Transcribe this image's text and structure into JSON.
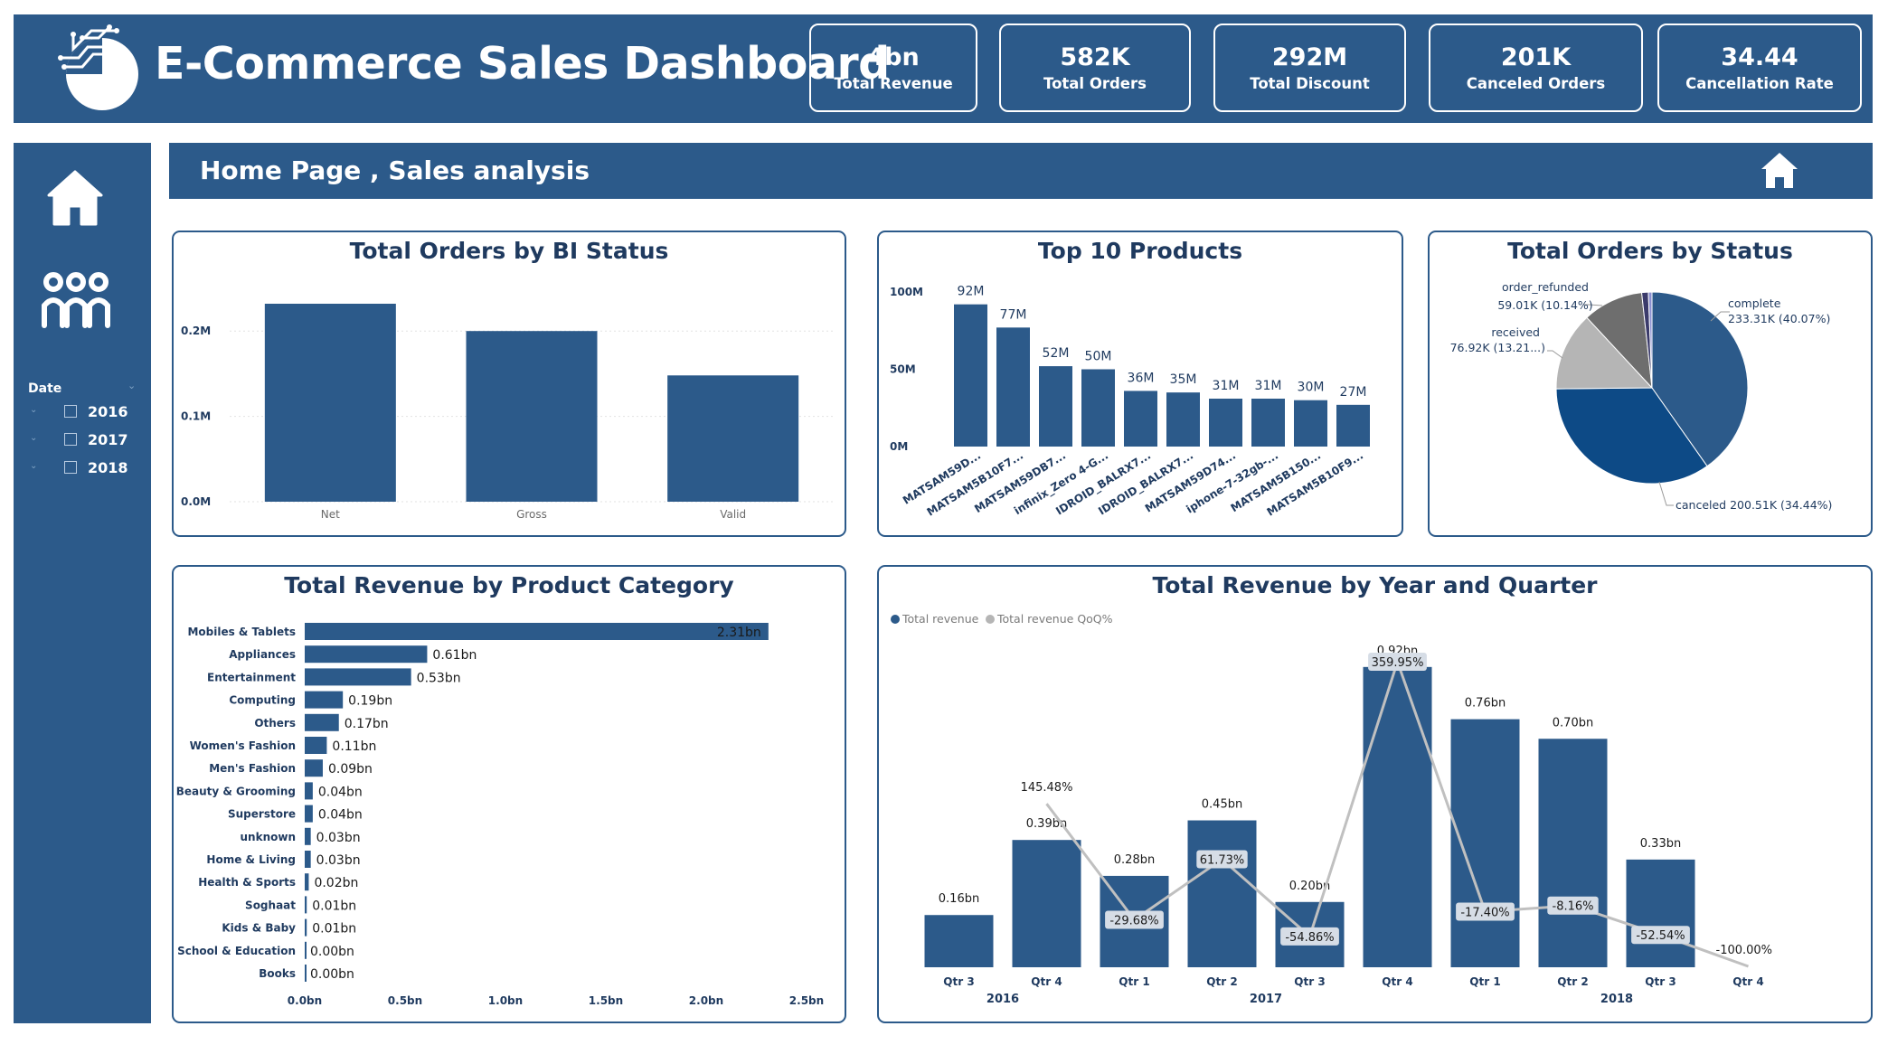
{
  "header": {
    "title": "E-Commerce Sales Dashboard",
    "kpis": [
      {
        "value": "4bn",
        "label": "Total Revenue"
      },
      {
        "value": "582K",
        "label": "Total Orders"
      },
      {
        "value": "292M",
        "label": "Total Discount"
      },
      {
        "value": "201K",
        "label": "Canceled Orders"
      },
      {
        "value": "34.44",
        "label": "Cancellation Rate"
      }
    ]
  },
  "sidebar": {
    "date_label": "Date",
    "years": [
      "2016",
      "2017",
      "2018"
    ]
  },
  "page": {
    "title": "Home Page , Sales analysis"
  },
  "colors": {
    "navy": "#2c5a8a",
    "bar": "#2c5a8a",
    "pie_dark": "#0d4a86",
    "gray": "#b5b5b5",
    "darkgray": "#6e6e6e",
    "line": "#c0c0c0"
  },
  "chart_data": [
    {
      "id": "bi_status",
      "type": "bar",
      "title": "Total Orders by BI Status",
      "categories": [
        "Net",
        "Gross",
        "Valid"
      ],
      "values": [
        0.232,
        0.2,
        0.148
      ],
      "ylim": [
        0,
        0.25
      ],
      "yticks": [
        0,
        0.1,
        0.2
      ],
      "ytick_labels": [
        "0.0M",
        "0.1M",
        "0.2M"
      ],
      "grid": true
    },
    {
      "id": "top_products",
      "type": "bar",
      "title": "Top 10 Products",
      "categories": [
        "MATSAM59D...",
        "MATSAM5B10F7...",
        "MATSAM59DB7...",
        "infinix_Zero 4-G...",
        "IDROID_BALRX7...",
        "IDROID_BALRX7...",
        "MATSAM59D74...",
        "iphone-7-32gb-...",
        "MATSAM5B150...",
        "MATSAM5B10F9..."
      ],
      "values": [
        92,
        77,
        52,
        50,
        36,
        35,
        31,
        31,
        30,
        27
      ],
      "data_labels": [
        "92M",
        "77M",
        "52M",
        "50M",
        "36M",
        "35M",
        "31M",
        "31M",
        "30M",
        "27M"
      ],
      "ylim": [
        0,
        100
      ],
      "yticks": [
        0,
        50,
        100
      ],
      "ytick_labels": [
        "0M",
        "50M",
        "100M"
      ]
    },
    {
      "id": "orders_status",
      "type": "pie",
      "title": "Total Orders by Status",
      "slices": [
        {
          "name": "complete",
          "value": 233.31,
          "label1": "complete",
          "label2": "233.31K (40.07%)",
          "color": "#2c5a8a"
        },
        {
          "name": "canceled",
          "value": 200.51,
          "label1": "canceled 200.51K (34.44%)",
          "label2": "",
          "color": "#0d4a86"
        },
        {
          "name": "received",
          "value": 76.92,
          "label1": "received",
          "label2": "76.92K (13.21...)",
          "color": "#b5b5b5"
        },
        {
          "name": "order_refunded",
          "value": 59.01,
          "label1": "order_refunded",
          "label2": "59.01K (10.14%)",
          "color": "#6e6e6e"
        },
        {
          "name": "other_a",
          "value": 6.5,
          "label1": "",
          "label2": "",
          "color": "#3b3b6b"
        },
        {
          "name": "other_b",
          "value": 3.5,
          "label1": "",
          "label2": "",
          "color": "#8a8fd0"
        }
      ]
    },
    {
      "id": "category_revenue",
      "type": "bar",
      "orientation": "horizontal",
      "title": "Total Revenue by Product Category",
      "categories": [
        "Mobiles & Tablets",
        "Appliances",
        "Entertainment",
        "Computing",
        "Others",
        "Women's Fashion",
        "Men's Fashion",
        "Beauty & Grooming",
        "Superstore",
        "unknown",
        "Home & Living",
        "Health & Sports",
        "Soghaat",
        "Kids & Baby",
        "School & Education",
        "Books"
      ],
      "values": [
        2.31,
        0.61,
        0.53,
        0.19,
        0.17,
        0.11,
        0.09,
        0.04,
        0.04,
        0.03,
        0.03,
        0.02,
        0.01,
        0.01,
        0.0,
        0.0
      ],
      "data_labels": [
        "2.31bn",
        "0.61bn",
        "0.53bn",
        "0.19bn",
        "0.17bn",
        "0.11bn",
        "0.09bn",
        "0.04bn",
        "0.04bn",
        "0.03bn",
        "0.03bn",
        "0.02bn",
        "0.01bn",
        "0.01bn",
        "0.00bn",
        "0.00bn"
      ],
      "xlim": [
        0,
        2.5
      ],
      "xticks": [
        0,
        0.5,
        1.0,
        1.5,
        2.0,
        2.5
      ],
      "xtick_labels": [
        "0.0bn",
        "0.5bn",
        "1.0bn",
        "1.5bn",
        "2.0bn",
        "2.5bn"
      ]
    },
    {
      "id": "revenue_quarter",
      "type": "bar",
      "title": "Total Revenue by Year and Quarter",
      "legend": [
        "Total revenue",
        "Total revenue QoQ%"
      ],
      "categories": [
        "Qtr 3",
        "Qtr 4",
        "Qtr 1",
        "Qtr 2",
        "Qtr 3",
        "Qtr 4",
        "Qtr 1",
        "Qtr 2",
        "Qtr 3",
        "Qtr 4"
      ],
      "years": [
        {
          "label": "2016",
          "from": 0,
          "to": 1
        },
        {
          "label": "2017",
          "from": 2,
          "to": 5
        },
        {
          "label": "2018",
          "from": 6,
          "to": 9
        }
      ],
      "series": [
        {
          "name": "Total revenue",
          "values": [
            0.16,
            0.39,
            0.28,
            0.45,
            0.2,
            0.92,
            0.76,
            0.7,
            0.33,
            0.0
          ],
          "data_labels": [
            "0.16bn",
            "0.39bn",
            "0.28bn",
            "0.45bn",
            "0.20bn",
            "0.92bn",
            "0.76bn",
            "0.70bn",
            "0.33bn",
            ""
          ]
        },
        {
          "name": "Total revenue QoQ%",
          "values": [
            null,
            145.48,
            -29.68,
            61.73,
            -54.86,
            359.95,
            -17.4,
            -8.16,
            -52.54,
            -100.0
          ],
          "data_labels": [
            "",
            "145.48%",
            "-29.68%",
            "61.73%",
            "-54.86%",
            "359.95%",
            "-17.40%",
            "-8.16%",
            "-52.54%",
            "-100.00%"
          ]
        }
      ],
      "ylim": [
        0,
        0.95
      ]
    }
  ]
}
